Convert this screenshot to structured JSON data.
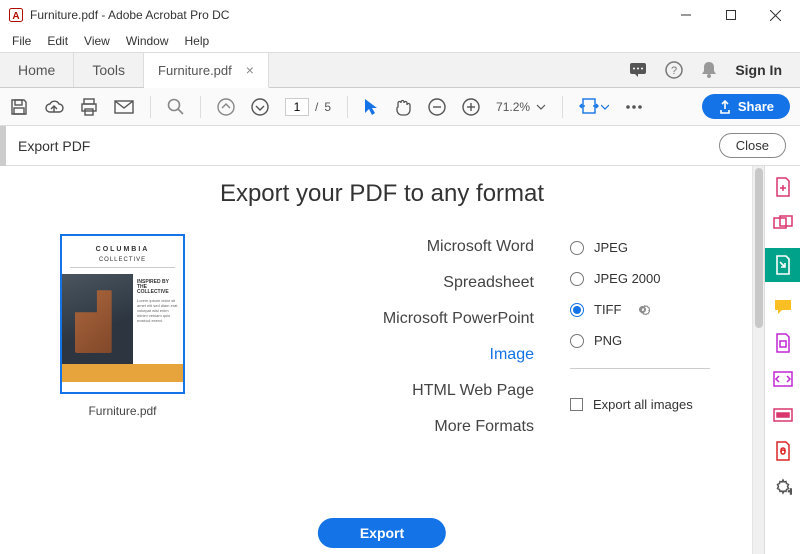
{
  "window": {
    "title": "Furniture.pdf - Adobe Acrobat Pro DC"
  },
  "menu": [
    "File",
    "Edit",
    "View",
    "Window",
    "Help"
  ],
  "tabs": {
    "home": "Home",
    "tools": "Tools",
    "doc": "Furniture.pdf",
    "signin": "Sign In"
  },
  "toolbar": {
    "page_current": "1",
    "page_sep": "/",
    "page_total": "5",
    "zoom": "71.2%",
    "share": "Share"
  },
  "subbar": {
    "title": "Export PDF",
    "close": "Close"
  },
  "export": {
    "heading": "Export your PDF to any format",
    "thumb_title": "COLUMBIA",
    "thumb_sub": "COLLECTIVE",
    "thumb_text_hd": "INSPIRED BY THE COLLECTIVE",
    "thumb_label": "Furniture.pdf",
    "formats": {
      "word": "Microsoft Word",
      "spreadsheet": "Spreadsheet",
      "ppt": "Microsoft PowerPoint",
      "image": "Image",
      "html": "HTML Web Page",
      "more": "More Formats"
    },
    "options": {
      "jpeg": "JPEG",
      "jpeg2000": "JPEG 2000",
      "tiff": "TIFF",
      "png": "PNG",
      "export_all": "Export all images"
    },
    "button": "Export"
  }
}
